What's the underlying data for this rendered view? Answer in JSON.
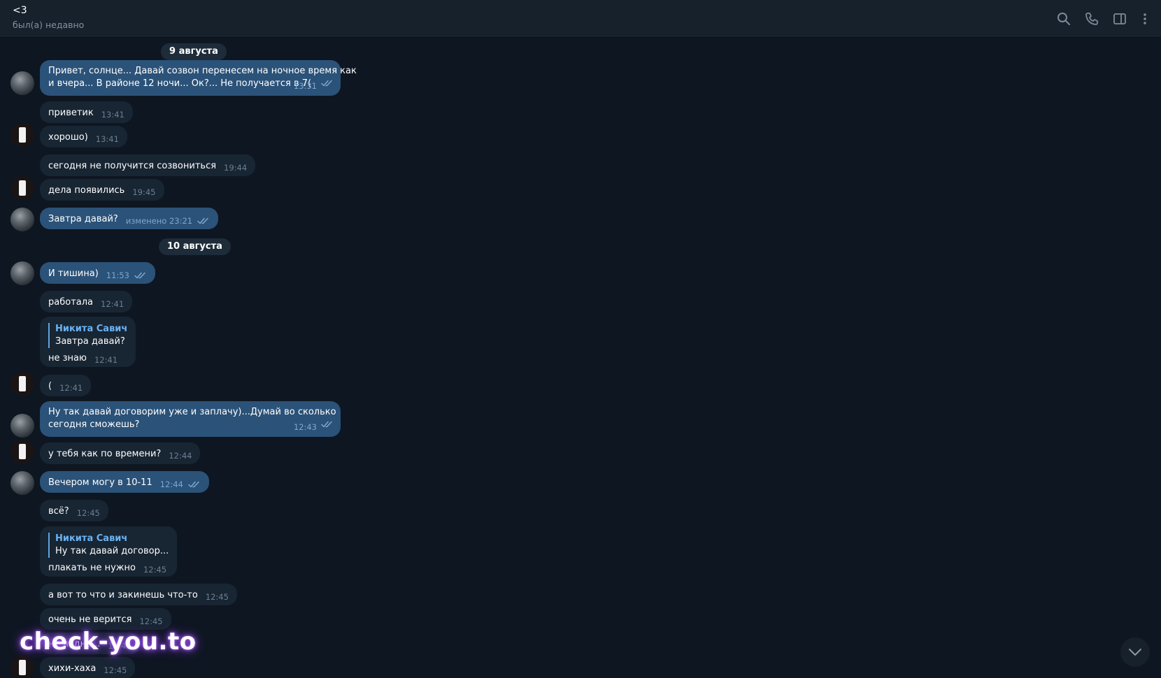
{
  "header": {
    "title": "<3",
    "status": "был(а) недавно",
    "icons": [
      "search-icon",
      "phone-icon",
      "sidebar-toggle-icon",
      "more-vertical-icon"
    ]
  },
  "dates": [
    "9 августа",
    "10 августа"
  ],
  "messages": [
    {
      "dir": "out",
      "text": "Привет, солнце... Давай созвон перенесем на ночное время как",
      "text2": "и вчера... В районе 12 ночи... Ок?... Не получается в 7(",
      "time": "13:31",
      "read": true
    },
    {
      "dir": "in",
      "text": "приветик",
      "time": "13:41"
    },
    {
      "dir": "in",
      "text": "хорошо)",
      "time": "13:41"
    },
    {
      "dir": "in",
      "text": "сегодня не получится созвониться",
      "time": "19:44"
    },
    {
      "dir": "in",
      "text": "дела появились",
      "time": "19:45"
    },
    {
      "dir": "out",
      "text": "Завтра давай?",
      "time": "изменено 23:21",
      "read": true
    },
    {
      "dir": "out",
      "text": "И тишина)",
      "time": "11:53",
      "read": true
    },
    {
      "dir": "in",
      "text": "работала",
      "time": "12:41"
    },
    {
      "dir": "in",
      "reply_name": "Никита Савич",
      "reply_text": "Завтра давай?",
      "text": "не знаю",
      "time": "12:41"
    },
    {
      "dir": "in",
      "text": "(",
      "time": "12:41"
    },
    {
      "dir": "out",
      "text": "Ну так давай договорим уже и заплачу)...Думай во сколько",
      "text2": "сегодня сможешь?",
      "time": "12:43",
      "read": true
    },
    {
      "dir": "in",
      "text": "у тебя как по времени?",
      "time": "12:44"
    },
    {
      "dir": "out",
      "text": "Вечером могу в 10-11",
      "time": "12:44",
      "read": true
    },
    {
      "dir": "in",
      "text": "всё?",
      "time": "12:45"
    },
    {
      "dir": "in",
      "reply_name": "Никита Савич",
      "reply_text": "Ну так давай договор...",
      "text": "плакать не нужно",
      "time": "12:45"
    },
    {
      "dir": "in",
      "text": "а вот то что и закинешь что-то",
      "time": "12:45"
    },
    {
      "dir": "in",
      "text": "очень не верится",
      "time": "12:45"
    },
    {
      "dir": "in",
      "text": "ну ладно...",
      "time": "12:45"
    },
    {
      "dir": "in",
      "text": "хихи-хаха",
      "time": "12:45"
    }
  ],
  "watermark": "check-you.to",
  "colors": {
    "background": "#0e1621",
    "header": "#17212b",
    "incoming": "#182533",
    "outgoing": "#2b5278",
    "accent": "#6ab3f3",
    "watermark_glow": "#9b4ff0"
  }
}
